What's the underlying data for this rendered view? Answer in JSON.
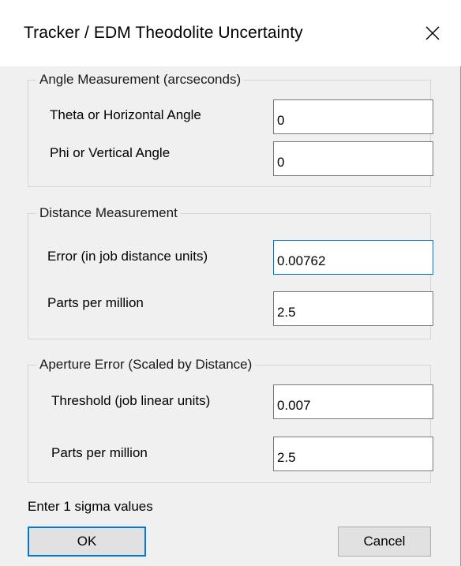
{
  "window": {
    "title": "Tracker / EDM Theodolite Uncertainty",
    "close_icon": "close-icon"
  },
  "angle_group": {
    "legend": "Angle Measurement (arcseconds)",
    "theta_label": "Theta or Horizontal Angle",
    "theta_value": "0",
    "phi_label": "Phi or Vertical Angle",
    "phi_value": "0"
  },
  "distance_group": {
    "legend": "Distance Measurement",
    "error_label": "Error (in job distance units)",
    "error_value": "0.00762",
    "ppm_label": "Parts per million",
    "ppm_value": "2.5"
  },
  "aperture_group": {
    "legend": "Aperture Error (Scaled by Distance)",
    "threshold_label": "Threshold (job linear units)",
    "threshold_value": "0.007",
    "ppm_label": "Parts per million",
    "ppm_value": "2.5"
  },
  "footnote": "Enter 1 sigma values",
  "buttons": {
    "ok": "OK",
    "cancel": "Cancel"
  },
  "colors": {
    "focus_accent": "#0078d7",
    "dialog_background": "#f0f0f0"
  }
}
